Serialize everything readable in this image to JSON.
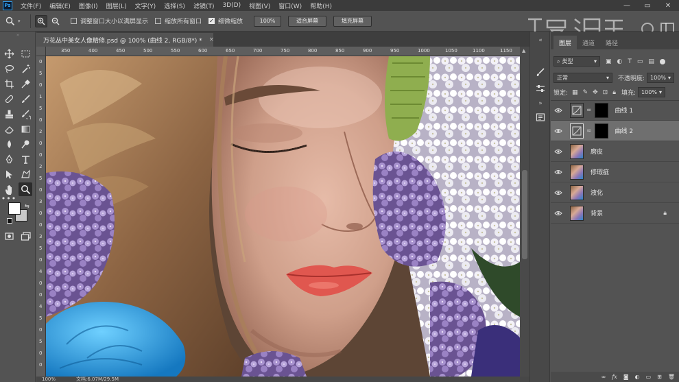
{
  "menu": {
    "logo": "Ps",
    "items": [
      "文件(F)",
      "编辑(E)",
      "图像(I)",
      "图层(L)",
      "文字(Y)",
      "选择(S)",
      "滤镜(T)",
      "3D(D)",
      "视图(V)",
      "窗口(W)",
      "帮助(H)"
    ]
  },
  "options": {
    "resize_windows": "调整窗口大小以满屏显示",
    "zoom_all": "缩放所有窗口",
    "scrubby_zoom": "细微缩放",
    "zoom_level": "100%",
    "fit_screen": "适合屏幕",
    "fill_screen": "填充屏幕"
  },
  "document": {
    "tab_title": "万花丛中美女人像精修.psd @ 100% (曲线 2, RGB/8*) *",
    "close": "×",
    "status_zoom": "100%",
    "status_doc": "文档:6.07M/29.5M"
  },
  "rulers": {
    "h": [
      "350",
      "400",
      "450",
      "500",
      "550",
      "600",
      "650",
      "700",
      "750",
      "800",
      "850",
      "900",
      "950",
      "1000",
      "1050",
      "1100",
      "1150"
    ],
    "v": [
      "0",
      "5",
      "0",
      "1",
      "5",
      "0",
      "2",
      "0",
      "0",
      "2",
      "5",
      "0",
      "3",
      "0",
      "0",
      "3",
      "5",
      "0",
      "4",
      "0",
      "0",
      "4",
      "5",
      "0",
      "5",
      "0",
      "0"
    ]
  },
  "layers_panel": {
    "tabs": [
      "图层",
      "通道",
      "路径"
    ],
    "filter": "类型",
    "blend_mode": "正常",
    "opacity_label": "不透明度:",
    "opacity_value": "100%",
    "lock_label": "锁定:",
    "fill_label": "填充:",
    "fill_value": "100%",
    "layers": [
      {
        "name": "曲线 1",
        "type": "adjustment"
      },
      {
        "name": "曲线 2",
        "type": "adjustment",
        "selected": true
      },
      {
        "name": "磨皮",
        "type": "image"
      },
      {
        "name": "修瑕疵",
        "type": "image"
      },
      {
        "name": "液化",
        "type": "image"
      },
      {
        "name": "背景",
        "type": "image",
        "locked": true
      }
    ]
  },
  "colors": {
    "accent": "#31a8ff",
    "panel_bg": "#535353",
    "menubar_bg": "#3b3b3b",
    "selected_layer": "#6f6f6f"
  }
}
